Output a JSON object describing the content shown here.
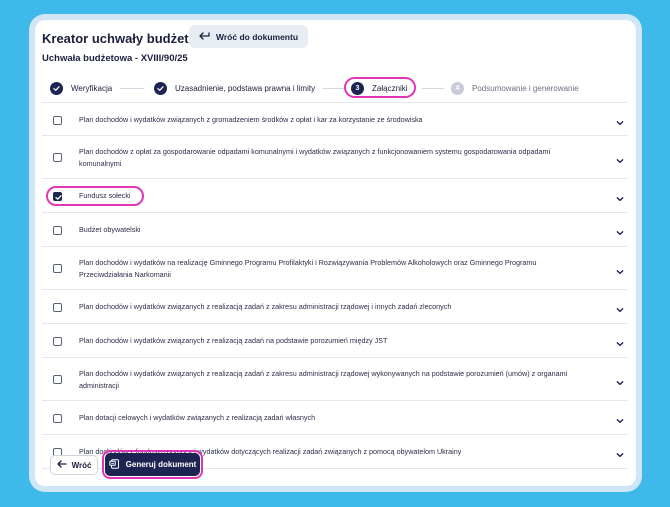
{
  "header": {
    "title": "Kreator uchwały budżetowej",
    "back_to_doc": "Wróć do dokumentu",
    "subtitle": "Uchwała budżetowa - XVIII/90/25"
  },
  "steps": [
    {
      "number": "",
      "label": "Weryfikacja",
      "state": "done"
    },
    {
      "number": "",
      "label": "Uzasadnienie, podstawa prawna i limity",
      "state": "done"
    },
    {
      "number": "3",
      "label": "Załączniki",
      "state": "current"
    },
    {
      "number": "4",
      "label": "Podsumowanie i generowanie",
      "state": "todo"
    }
  ],
  "attachments": [
    {
      "label": "Plan dochodów i wydatków związanych z gromadzeniem środków z opłat i kar za korzystanie ze środowiska",
      "checked": false
    },
    {
      "label": "Plan dochodów z opłat za gospodarowanie odpadami komunalnymi i wydatków związanych z funkcjonowaniem systemu gospodarowania odpadami komunalnymi",
      "checked": false
    },
    {
      "label": "Fundusz sołecki",
      "checked": true
    },
    {
      "label": "Budżet obywatelski",
      "checked": false
    },
    {
      "label": "Plan dochodów i wydatków na realizację Gminnego Programu Profilaktyki i Rozwiązywania Problemów Alkoholowych oraz Gminnego Programu Przeciwdziałania Narkomanii",
      "checked": false
    },
    {
      "label": "Plan dochodów i wydatków związanych z realizacją zadań z zakresu administracji rządowej i innych zadań zleconych",
      "checked": false
    },
    {
      "label": "Plan dochodów i wydatków związanych z realizacją zadań na podstawie porozumień między JST",
      "checked": false
    },
    {
      "label": "Plan dochodów i wydatków związanych z realizacją zadań z zakresu administracji rządowej wykonywanych na podstawie porozumień (umów) z organami administracji",
      "checked": false
    },
    {
      "label": "Plan dotacji celowych i wydatków związanych z realizacją zadań własnych",
      "checked": false
    },
    {
      "label": "Plan dochodów z funduszu pomocy i wydatków dotyczących realizacji zadań związanych z pomocą obywatelom Ukrainy",
      "checked": false
    }
  ],
  "footer": {
    "back_label": "Wróć",
    "generate_label": "Generuj dokument"
  },
  "colors": {
    "accent": "#1e2452",
    "highlight": "#e036b5",
    "background": "#3fb8ea"
  }
}
